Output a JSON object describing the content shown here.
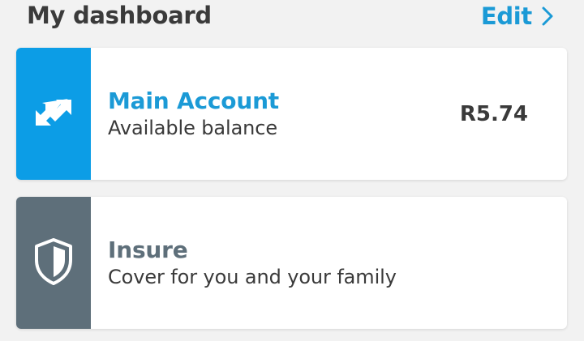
{
  "header": {
    "title": "My dashboard",
    "edit_label": "Edit",
    "edit_icon": "chevron-right-icon"
  },
  "cards": [
    {
      "title": "Main Account",
      "subtitle": "Available balance",
      "amount": "R5.74",
      "icon": "transfer-arrows-icon",
      "panel_color": "#0c9de6",
      "title_color": "#1b9ad6"
    },
    {
      "title": "Insure",
      "subtitle": "Cover for you and your family",
      "icon": "shield-icon",
      "panel_color": "#5e6f7a",
      "title_color": "#5e6f7a"
    }
  ],
  "colors": {
    "accent": "#1b9ad6",
    "background": "#f2f2f2",
    "text": "#3a3a3a"
  }
}
